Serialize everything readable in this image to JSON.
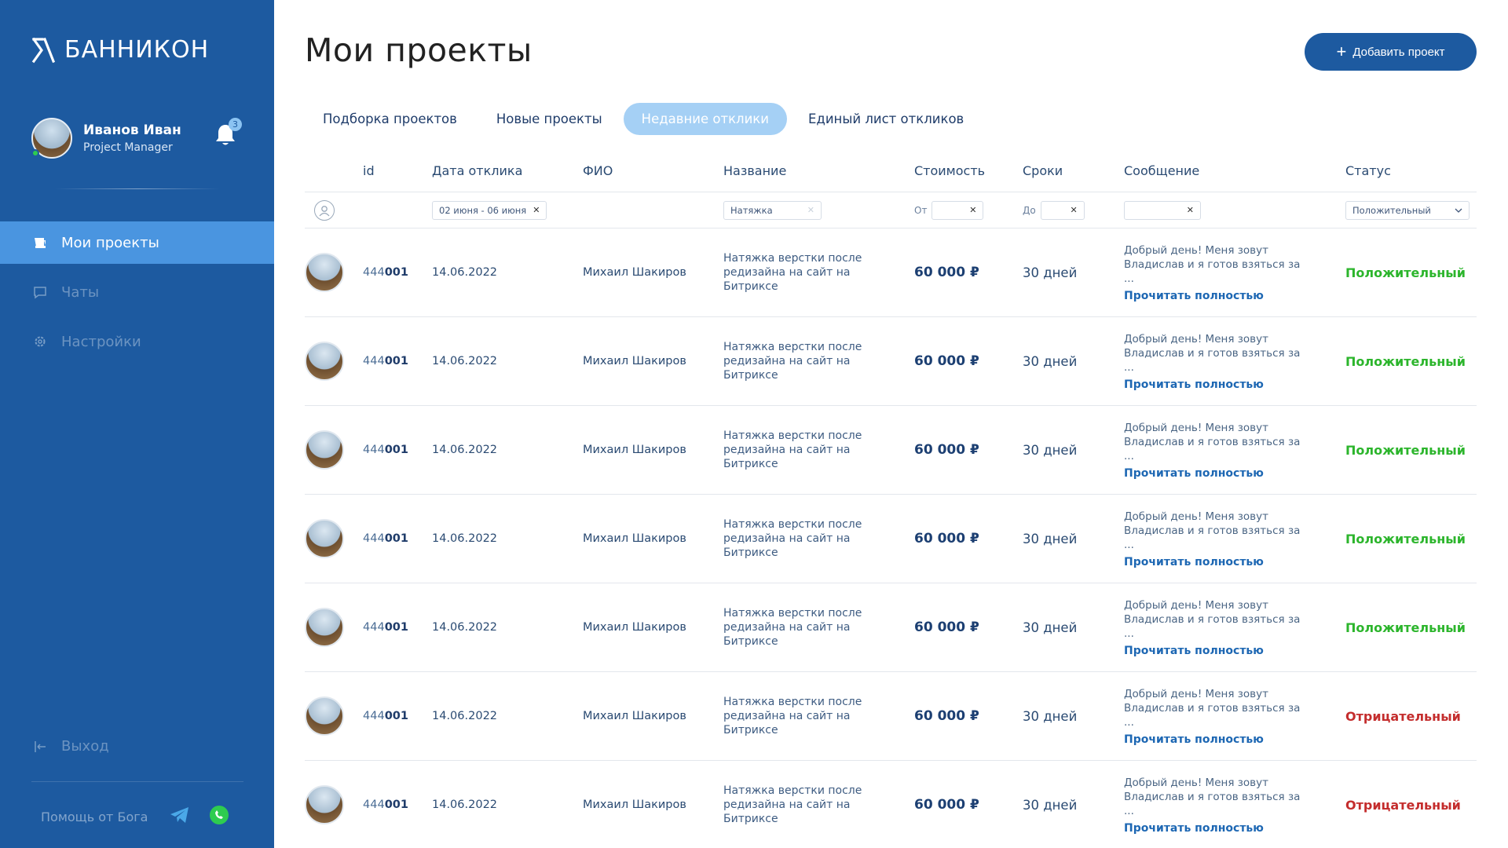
{
  "brand": {
    "name": "БАННИКОН"
  },
  "user": {
    "name": "Иванов Иван",
    "role": "Project Manager",
    "notifications": "3"
  },
  "nav": {
    "items": [
      {
        "label": "Мои проекты",
        "icon": "projects-icon",
        "active": true
      },
      {
        "label": "Чаты",
        "icon": "chat-icon",
        "active": false
      },
      {
        "label": "Настройки",
        "icon": "gear-icon",
        "active": false
      }
    ],
    "logout": "Выход",
    "help": "Помощь от Бога"
  },
  "page": {
    "title": "Мои проекты",
    "add_button": "Добавить проект"
  },
  "tabs": [
    {
      "label": "Подборка проектов",
      "active": false
    },
    {
      "label": "Новые проекты",
      "active": false
    },
    {
      "label": "Недавние отклики",
      "active": true
    },
    {
      "label": "Единый лист откликов",
      "active": false
    }
  ],
  "table": {
    "headers": {
      "id": "id",
      "date": "Дата отклика",
      "fio": "ФИО",
      "name": "Название",
      "cost": "Стоимость",
      "term": "Сроки",
      "message": "Сообщение",
      "status": "Статус"
    },
    "filters": {
      "date": "02 июня - 06 июня",
      "name": "Натяжка",
      "cost_label": "От",
      "term_label": "До",
      "status": "Положительный"
    },
    "rows": [
      {
        "id_prefix": "444",
        "id_suffix": "001",
        "date": "14.06.2022",
        "fio": "Михаил Шакиров",
        "name": "Натяжка верстки после редизайна на сайт на Битриксе",
        "cost": "60 000 ₽",
        "term": "30 дней",
        "message": "Добрый день! Меня зовут Владислав и я готов взяться за ...",
        "link": "Прочитать полностью",
        "status": "Положительный",
        "status_type": "positive"
      },
      {
        "id_prefix": "444",
        "id_suffix": "001",
        "date": "14.06.2022",
        "fio": "Михаил Шакиров",
        "name": "Натяжка верстки после редизайна на сайт на Битриксе",
        "cost": "60 000 ₽",
        "term": "30 дней",
        "message": "Добрый день! Меня зовут Владислав и я готов взяться за ...",
        "link": "Прочитать полностью",
        "status": "Положительный",
        "status_type": "positive"
      },
      {
        "id_prefix": "444",
        "id_suffix": "001",
        "date": "14.06.2022",
        "fio": "Михаил Шакиров",
        "name": "Натяжка верстки после редизайна на сайт на Битриксе",
        "cost": "60 000 ₽",
        "term": "30 дней",
        "message": "Добрый день! Меня зовут Владислав и я готов взяться за ...",
        "link": "Прочитать полностью",
        "status": "Положительный",
        "status_type": "positive"
      },
      {
        "id_prefix": "444",
        "id_suffix": "001",
        "date": "14.06.2022",
        "fio": "Михаил Шакиров",
        "name": "Натяжка верстки после редизайна на сайт на Битриксе",
        "cost": "60 000 ₽",
        "term": "30 дней",
        "message": "Добрый день! Меня зовут Владислав и я готов взяться за ...",
        "link": "Прочитать полностью",
        "status": "Положительный",
        "status_type": "positive"
      },
      {
        "id_prefix": "444",
        "id_suffix": "001",
        "date": "14.06.2022",
        "fio": "Михаил Шакиров",
        "name": "Натяжка верстки после редизайна на сайт на Битриксе",
        "cost": "60 000 ₽",
        "term": "30 дней",
        "message": "Добрый день! Меня зовут Владислав и я готов взяться за ...",
        "link": "Прочитать полностью",
        "status": "Положительный",
        "status_type": "positive"
      },
      {
        "id_prefix": "444",
        "id_suffix": "001",
        "date": "14.06.2022",
        "fio": "Михаил Шакиров",
        "name": "Натяжка верстки после редизайна на сайт на Битриксе",
        "cost": "60 000 ₽",
        "term": "30 дней",
        "message": "Добрый день! Меня зовут Владислав и я готов взяться за ...",
        "link": "Прочитать полностью",
        "status": "Отрицательный",
        "status_type": "negative"
      },
      {
        "id_prefix": "444",
        "id_suffix": "001",
        "date": "14.06.2022",
        "fio": "Михаил Шакиров",
        "name": "Натяжка верстки после редизайна на сайт на Битриксе",
        "cost": "60 000 ₽",
        "term": "30 дней",
        "message": "Добрый день! Меня зовут Владислав и я готов взяться за ...",
        "link": "Прочитать полностью",
        "status": "Отрицательный",
        "status_type": "negative"
      }
    ]
  },
  "colors": {
    "sidebar": "#1d5aa0",
    "accent": "#4a95e0",
    "tab_active": "#a5d0f5",
    "positive": "#2cb52c",
    "negative": "#c42d2d"
  }
}
